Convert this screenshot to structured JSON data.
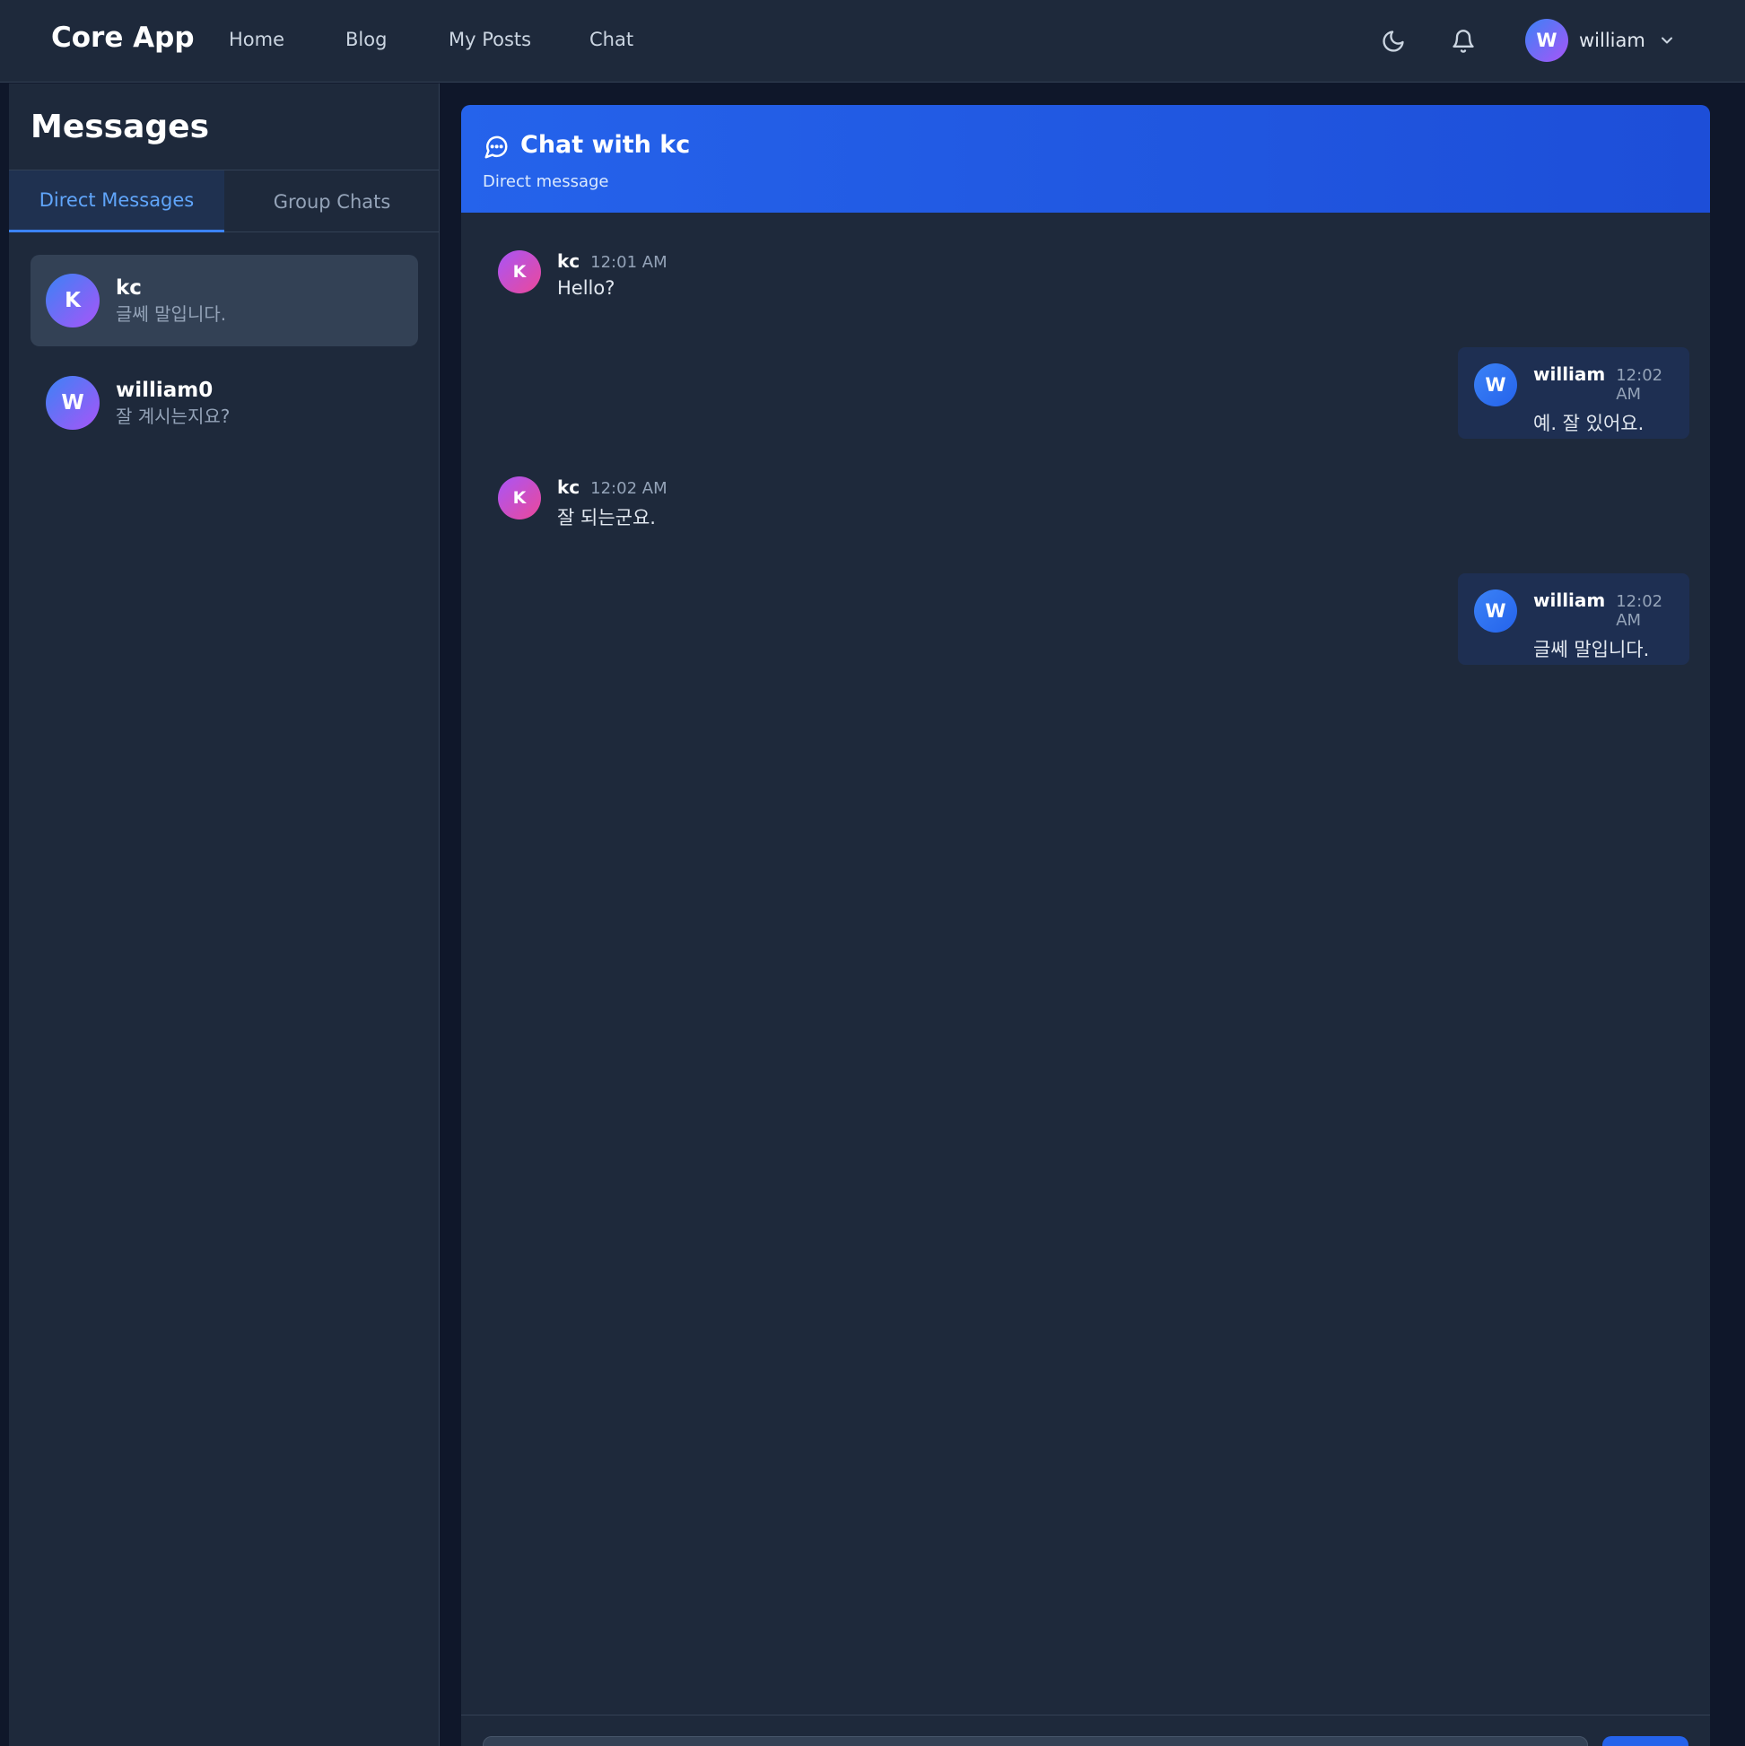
{
  "nav": {
    "brand": "Core App",
    "links": [
      "Home",
      "Blog",
      "My Posts",
      "Chat"
    ],
    "user": {
      "initial": "W",
      "name": "william"
    },
    "icons": [
      "moon-icon",
      "bell-icon",
      "chevron-down-icon"
    ]
  },
  "sidebar": {
    "title": "Messages",
    "tabs": [
      {
        "label": "Direct Messages",
        "active": true
      },
      {
        "label": "Group Chats",
        "active": false
      }
    ],
    "conversations": [
      {
        "initial": "K",
        "name": "kc",
        "preview": "글쎄 말입니다.",
        "selected": true
      },
      {
        "initial": "W",
        "name": "william0",
        "preview": "잘 계시는지요?",
        "selected": false
      }
    ]
  },
  "chat": {
    "title": "Chat with kc",
    "subtitle": "Direct message",
    "messages": [
      {
        "initial": "K",
        "sender": "kc",
        "time": "12:01 AM",
        "text": "Hello?",
        "mine": false
      },
      {
        "initial": "W",
        "sender": "william",
        "time": "12:02 AM",
        "text": "예. 잘 있어요.",
        "mine": true
      },
      {
        "initial": "K",
        "sender": "kc",
        "time": "12:02 AM",
        "text": "잘 되는군요.",
        "mine": false
      },
      {
        "initial": "W",
        "sender": "william",
        "time": "12:02 AM",
        "text": "글쎄 말입니다.",
        "mine": true
      }
    ]
  },
  "colors": {
    "background": "#0f172a",
    "panel": "#1e293b",
    "accent": "#2563eb",
    "active_tab_text": "#60a5fa"
  }
}
